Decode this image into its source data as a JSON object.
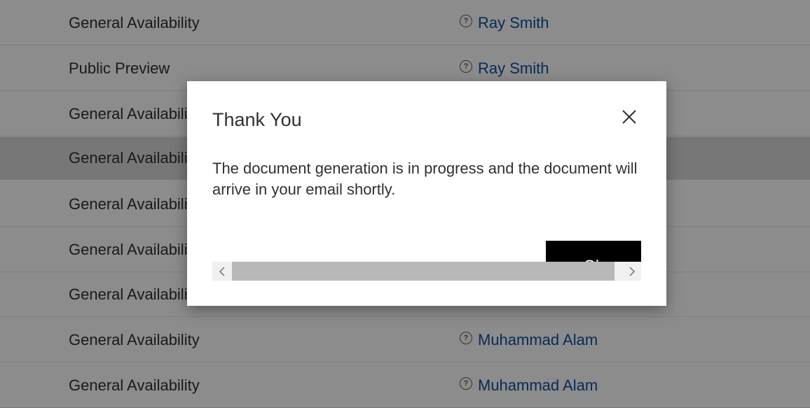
{
  "grid": {
    "rows": [
      {
        "status": "General Availability",
        "owner": "Ray Smith"
      },
      {
        "status": "Public Preview",
        "owner": "Ray Smith"
      },
      {
        "status": "General Availability",
        "owner": ""
      },
      {
        "status": "General Availability",
        "owner": "",
        "selected": true
      },
      {
        "status": "General Availability",
        "owner": ""
      },
      {
        "status": "General Availability",
        "owner": ""
      },
      {
        "status": "General Availability",
        "owner": ""
      },
      {
        "status": "General Availability",
        "owner": "Muhammad Alam"
      },
      {
        "status": "General Availability",
        "owner": "Muhammad Alam"
      }
    ],
    "owner_icon": "user-presence-icon",
    "owner_icon_glyph": "?"
  },
  "dialog": {
    "title": "Thank You",
    "message": "The document generation is in progress and the document will arrive in your email shortly.",
    "ok_label": "Ok",
    "close_icon": "close-icon"
  },
  "colors": {
    "link": "#0f4fa0",
    "button_bg": "#000000",
    "overlay": "rgba(0,0,0,0.45)"
  }
}
